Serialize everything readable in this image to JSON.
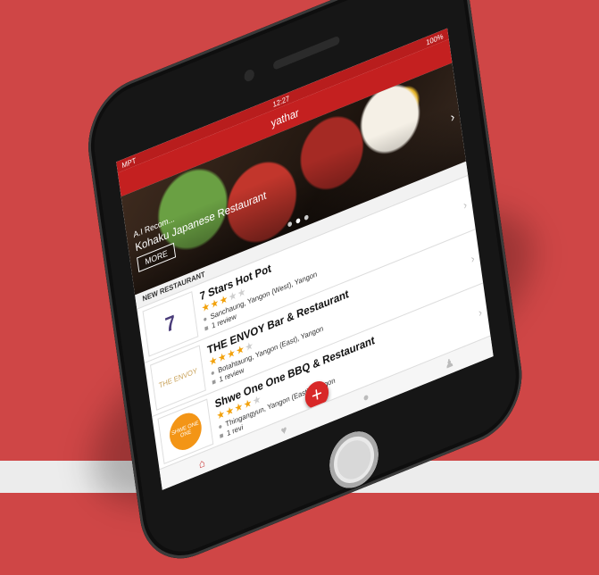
{
  "status_bar": {
    "carrier": "MPT",
    "time": "12:27",
    "battery": "100%"
  },
  "app": {
    "title": "yathar"
  },
  "hero": {
    "subtitle": "A.I Recom...",
    "title": "Kohaku Japanese Restaurant",
    "more_label": "MORE",
    "slides": 3,
    "active_slide": 2
  },
  "section": {
    "label": "NEW RESTAURANT"
  },
  "restaurants": [
    {
      "name": "7 Stars Hot Pot",
      "rating": 3,
      "max_rating": 5,
      "location": "Sanchaung, Yangon (West), Yangon",
      "reviews": "1 review",
      "logo": "7"
    },
    {
      "name": "THE ENVOY Bar & Restaurant",
      "rating": 4,
      "max_rating": 5,
      "location": "Botahtaung, Yangon (East), Yangon",
      "reviews": "1 review",
      "logo": "THE ENVOY"
    },
    {
      "name": "Shwe One One BBQ & Restaurant",
      "rating": 4,
      "max_rating": 5,
      "location": "Thingangyun, Yangon (East), Yangon",
      "reviews": "1 revi",
      "logo": "SHWE ONE ONE"
    }
  ],
  "fab": {
    "label": "+"
  },
  "tabbar": {
    "items": [
      {
        "icon": "home-icon",
        "glyph": "⌂",
        "active": true
      },
      {
        "icon": "heart-icon",
        "glyph": "♥",
        "active": false
      },
      {
        "icon": "chat-icon",
        "glyph": "●",
        "active": false
      },
      {
        "icon": "person-icon",
        "glyph": "♟",
        "active": false
      }
    ]
  },
  "colors": {
    "brand_red": "#c42020",
    "background": "#cf4646",
    "star": "#f2a10a"
  }
}
